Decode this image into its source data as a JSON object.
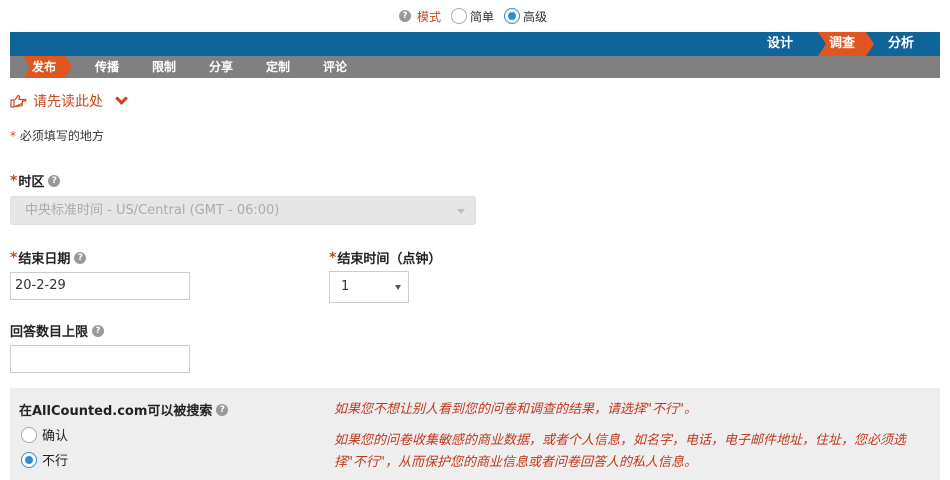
{
  "mode_bar": {
    "label": "模式",
    "options": [
      {
        "label": "简单",
        "checked": false
      },
      {
        "label": "高级",
        "checked": true
      }
    ]
  },
  "top_nav": {
    "items": [
      {
        "label": "设计",
        "active": false
      },
      {
        "label": "调查",
        "active": true
      },
      {
        "label": "分析",
        "active": false
      }
    ]
  },
  "sub_nav": {
    "items": [
      {
        "label": "发布",
        "active": true
      },
      {
        "label": "传播",
        "active": false
      },
      {
        "label": "限制",
        "active": false
      },
      {
        "label": "分享",
        "active": false
      },
      {
        "label": "定制",
        "active": false
      },
      {
        "label": "评论",
        "active": false
      }
    ]
  },
  "read_first": {
    "label": "请先读此处"
  },
  "required_note": {
    "star": "*",
    "text": "必须填写的地方"
  },
  "timezone": {
    "label": "时区",
    "value": "中央标准时间 - US/Central (GMT - 06:00)",
    "disabled": true
  },
  "end_date": {
    "label": "结束日期",
    "value": "20-2-29"
  },
  "end_time": {
    "label": "结束时间（点钟）",
    "value": "1"
  },
  "response_limit": {
    "label": "回答数目上限",
    "value": ""
  },
  "searchable": {
    "label": "在AllCounted.com可以被搜索",
    "options": [
      {
        "label": "确认",
        "checked": false
      },
      {
        "label": "不行",
        "checked": true
      }
    ],
    "note1": "如果您不想让别人看到您的问卷和调查的结果，请选择\"不行\"。",
    "note2": "如果您的问卷收集敏感的商业数据，或者个人信息，如名字，电话，电子邮件地址，住址，您必须选择\"不行\"，从而保护您的商业信息或者问卷回答人的私人信息。"
  },
  "colors": {
    "accent": "#e0561e",
    "nav_blue": "#0f6599",
    "subnav_gray": "#808080",
    "note_red": "#c0391b"
  }
}
